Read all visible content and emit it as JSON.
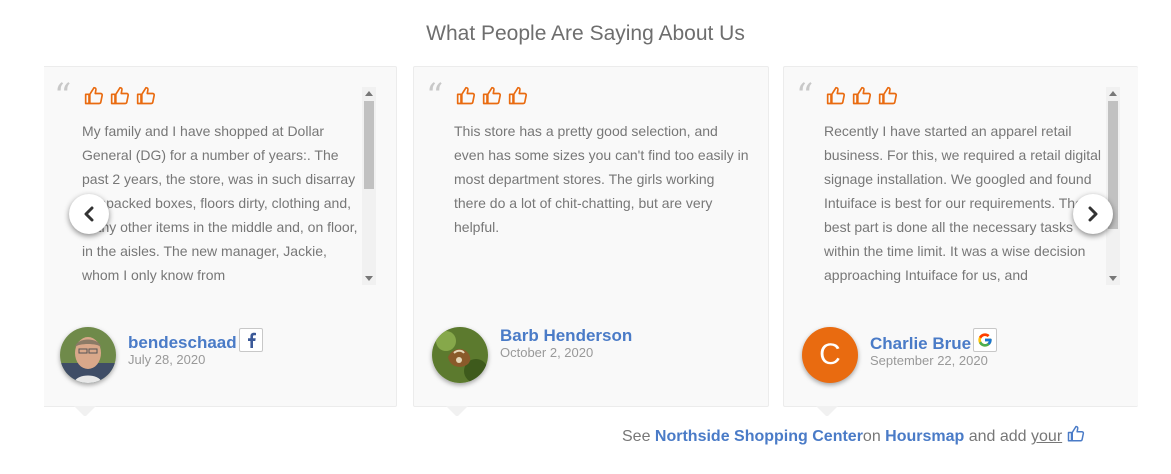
{
  "heading": "What People Are Saying About Us",
  "colors": {
    "accent": "#e96b10",
    "link": "#4a7bc7"
  },
  "reviews": [
    {
      "text": "My family and I have shopped at Dollar General (DG) for a number of years:. The past 2 years, the store, was in such disarray ( unpacked boxes, floors dirty, clothing and, many other items in the middle and, on floor, in the aisles. The new manager, Jackie, whom I only know from",
      "rating_thumbs": 3,
      "name": "bendeschaad",
      "date": "July 28, 2020",
      "source_icon": "facebook-icon"
    },
    {
      "text": "This store has a pretty good selection, and even has some sizes you can't find too easily in most department stores. The girls working there do a lot of chit-chatting, but are very helpful.",
      "rating_thumbs": 3,
      "name": "Barb Henderson",
      "date": "October 2, 2020",
      "source_icon": ""
    },
    {
      "text": "Recently I have started an apparel retail business. For this, we required a retail digital signage installation. We googled and found Intuiface is best for our requirements. The best part is done all the necessary tasks within the time limit. It was a wise decision approaching Intuiface for us, and",
      "rating_thumbs": 3,
      "name": "Charlie Brue",
      "date": "September 22, 2020",
      "avatar_letter": "C",
      "source_icon": "google-icon"
    }
  ],
  "footer": {
    "see": "See ",
    "place": "Northside Shopping Center",
    "on": "on ",
    "site": "Hoursmap",
    "add": " and add ",
    "your": "your"
  }
}
